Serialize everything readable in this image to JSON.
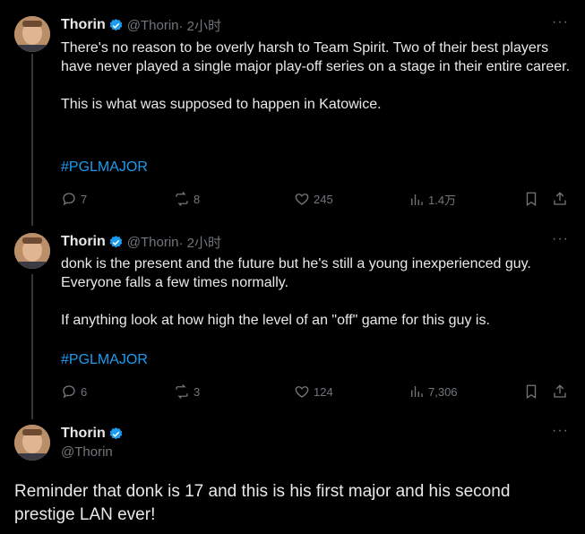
{
  "tweets": [
    {
      "name": "Thorin",
      "handle": "@Thorin",
      "time": "· 2小时",
      "more": "···",
      "text": "There's no reason to be overly harsh to Team Spirit.  Two of their best players have never played a single major play-off series on a stage in their entire career.\n\nThis is what was supposed to happen in Katowice.",
      "hashtag": "#PGLMAJOR",
      "replies": "7",
      "retweets": "8",
      "likes": "245",
      "views": "1.4万"
    },
    {
      "name": "Thorin",
      "handle": "@Thorin",
      "time": "· 2小时",
      "more": "···",
      "text": "donk is the present and the future but he's still a young inexperienced guy.  Everyone falls a few times normally.\n\nIf anything look at how high the level of an \"off\" game for this guy is.",
      "hashtag": "#PGLMAJOR",
      "replies": "6",
      "retweets": "3",
      "likes": "124",
      "views": "7,306"
    }
  ],
  "main_tweet": {
    "name": "Thorin",
    "handle": "@Thorin",
    "more": "···",
    "text": "Reminder that donk is 17 and this is his first major and his second prestige LAN ever!"
  },
  "colors": {
    "accent": "#1d9bf0",
    "muted": "#71767b",
    "text": "#e7e9ea",
    "background": "#000000"
  }
}
